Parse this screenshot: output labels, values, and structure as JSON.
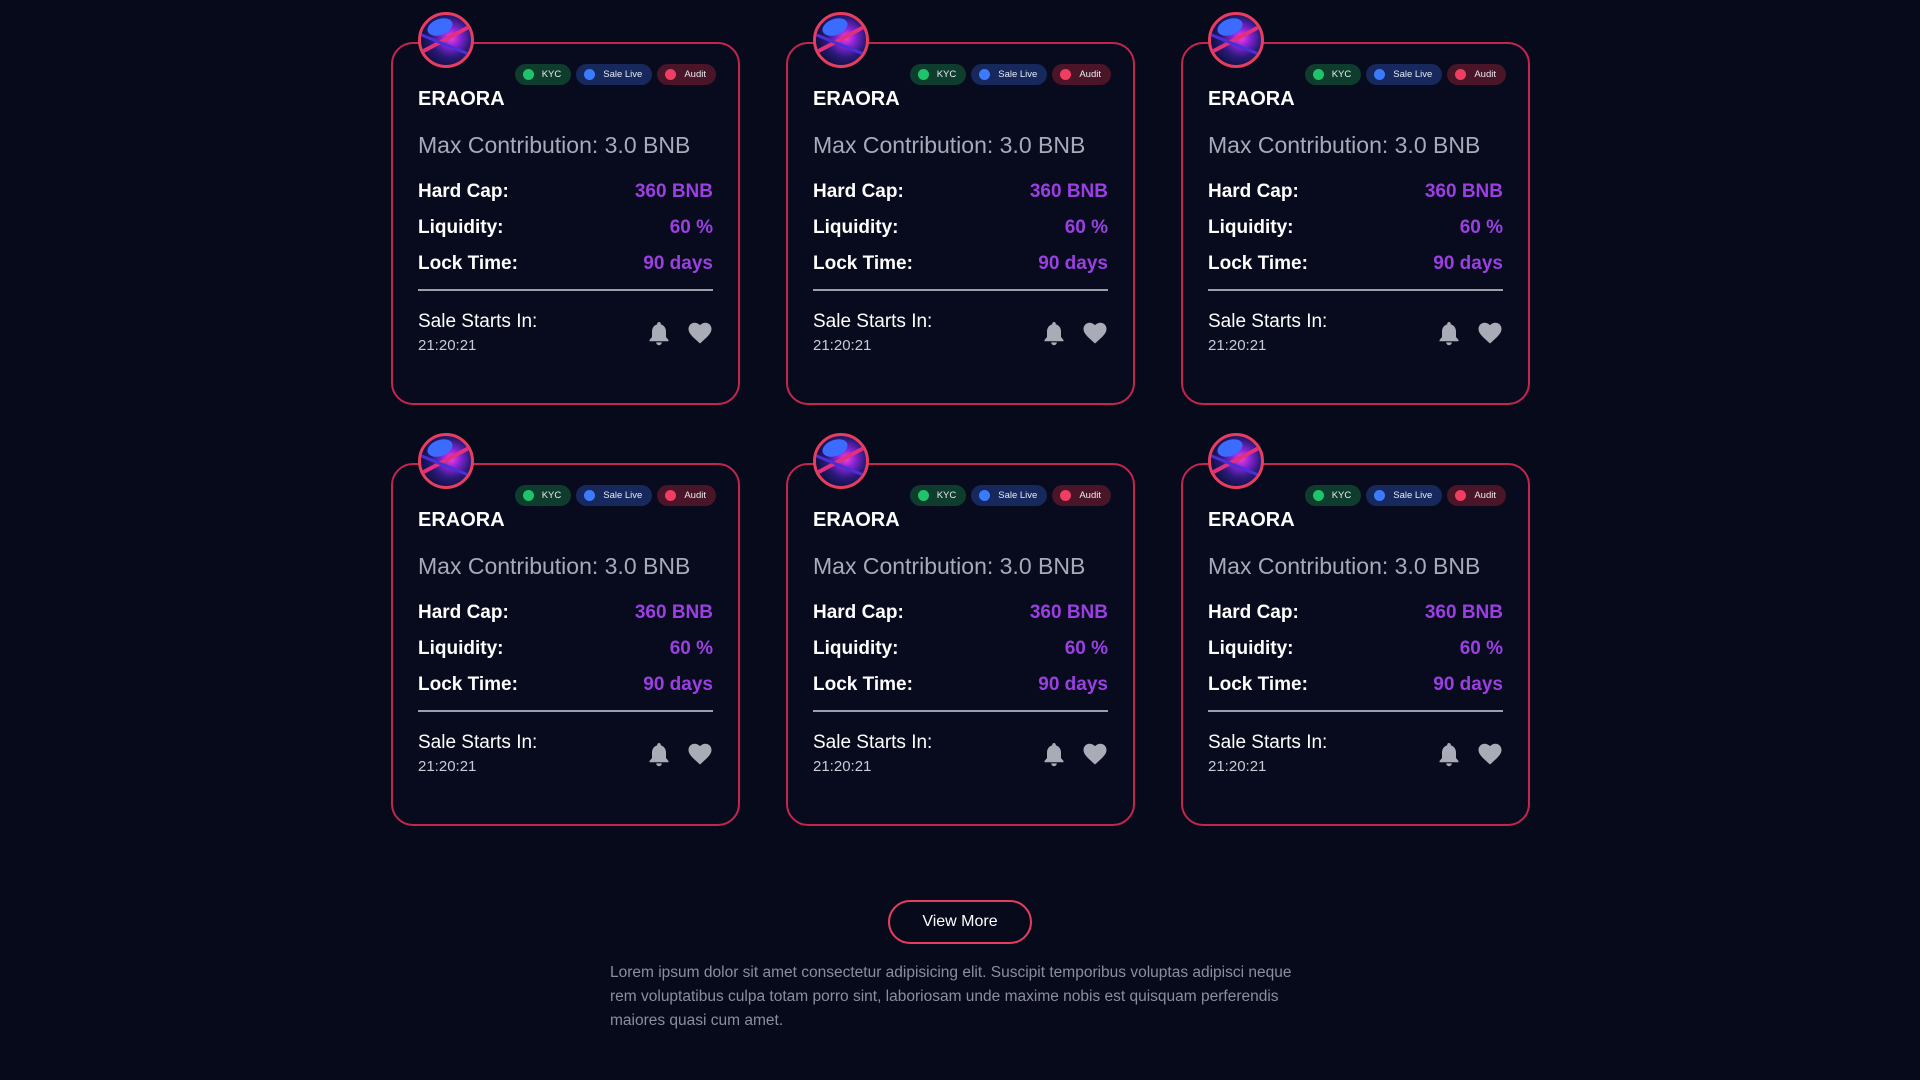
{
  "cards": [
    {
      "name": "ERAORA",
      "badges": {
        "kyc": "KYC",
        "live": "Sale Live",
        "audit": "Audit"
      },
      "max_contribution": "Max Contribution: 3.0 BNB",
      "hard_cap_label": "Hard Cap:",
      "hard_cap": "360 BNB",
      "liquidity_label": "Liquidity:",
      "liquidity": "60 %",
      "lock_label": "Lock Time:",
      "lock_time": "90 days",
      "sale_label": "Sale Starts In:",
      "sale_time": "21:20:21"
    },
    {
      "name": "ERAORA",
      "badges": {
        "kyc": "KYC",
        "live": "Sale Live",
        "audit": "Audit"
      },
      "max_contribution": "Max Contribution: 3.0 BNB",
      "hard_cap_label": "Hard Cap:",
      "hard_cap": "360 BNB",
      "liquidity_label": "Liquidity:",
      "liquidity": "60 %",
      "lock_label": "Lock Time:",
      "lock_time": "90 days",
      "sale_label": "Sale Starts In:",
      "sale_time": "21:20:21"
    },
    {
      "name": "ERAORA",
      "badges": {
        "kyc": "KYC",
        "live": "Sale Live",
        "audit": "Audit"
      },
      "max_contribution": "Max Contribution: 3.0 BNB",
      "hard_cap_label": "Hard Cap:",
      "hard_cap": "360 BNB",
      "liquidity_label": "Liquidity:",
      "liquidity": "60 %",
      "lock_label": "Lock Time:",
      "lock_time": "90 days",
      "sale_label": "Sale Starts In:",
      "sale_time": "21:20:21"
    },
    {
      "name": "ERAORA",
      "badges": {
        "kyc": "KYC",
        "live": "Sale Live",
        "audit": "Audit"
      },
      "max_contribution": "Max Contribution: 3.0 BNB",
      "hard_cap_label": "Hard Cap:",
      "hard_cap": "360 BNB",
      "liquidity_label": "Liquidity:",
      "liquidity": "60 %",
      "lock_label": "Lock Time:",
      "lock_time": "90 days",
      "sale_label": "Sale Starts In:",
      "sale_time": "21:20:21"
    },
    {
      "name": "ERAORA",
      "badges": {
        "kyc": "KYC",
        "live": "Sale Live",
        "audit": "Audit"
      },
      "max_contribution": "Max Contribution: 3.0 BNB",
      "hard_cap_label": "Hard Cap:",
      "hard_cap": "360 BNB",
      "liquidity_label": "Liquidity:",
      "liquidity": "60 %",
      "lock_label": "Lock Time:",
      "lock_time": "90 days",
      "sale_label": "Sale Starts In:",
      "sale_time": "21:20:21"
    },
    {
      "name": "ERAORA",
      "badges": {
        "kyc": "KYC",
        "live": "Sale Live",
        "audit": "Audit"
      },
      "max_contribution": "Max Contribution: 3.0 BNB",
      "hard_cap_label": "Hard Cap:",
      "hard_cap": "360 BNB",
      "liquidity_label": "Liquidity:",
      "liquidity": "60 %",
      "lock_label": "Lock Time:",
      "lock_time": "90 days",
      "sale_label": "Sale Starts In:",
      "sale_time": "21:20:21"
    }
  ],
  "icons": {
    "avatar": "token-logo-icon",
    "notify": "bell-icon",
    "favorite": "heart-icon"
  },
  "colors": {
    "background": "#060a1b",
    "card_border": "#c4254d",
    "accent_value": "#9b3fe3",
    "kyc": "#1fc46a",
    "sale_live": "#3b7bff",
    "audit": "#ef3e62"
  },
  "view_more_label": "View More",
  "description": "Lorem ipsum dolor sit amet consectetur adipisicing elit. Suscipit temporibus voluptas adipisci neque rem voluptatibus culpa totam porro sint, laboriosam unde maxime nobis est quisquam perferendis maiores quasi cum amet."
}
